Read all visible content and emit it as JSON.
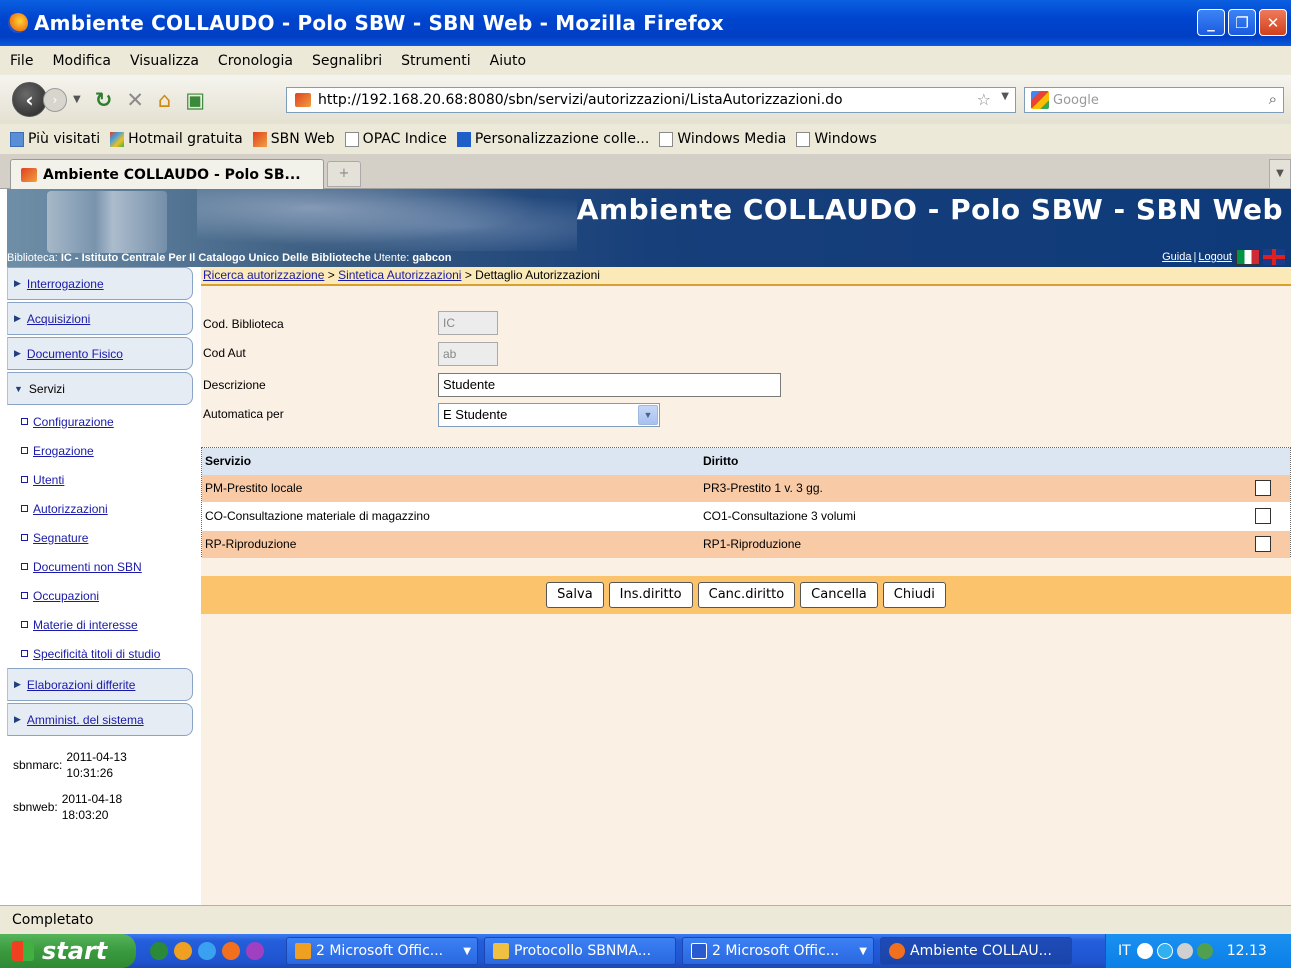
{
  "window": {
    "title": "Ambiente COLLAUDO - Polo SBW - SBN Web - Mozilla Firefox",
    "minimize": "_",
    "maximize": "❐",
    "close": "✕"
  },
  "menu": [
    "File",
    "Modifica",
    "Visualizza",
    "Cronologia",
    "Segnalibri",
    "Strumenti",
    "Aiuto"
  ],
  "navbar": {
    "url": "http://192.168.20.68:8080/sbn/servizi/autorizzazioni/ListaAutorizzazioni.do",
    "search_placeholder": "Google"
  },
  "bookmarks": [
    "Più visitati",
    "Hotmail gratuita",
    "SBN Web",
    "OPAC Indice",
    "Personalizzazione colle...",
    "Windows Media",
    "Windows"
  ],
  "tab": {
    "label": "Ambiente COLLAUDO - Polo SB...",
    "newtab": "+"
  },
  "banner": {
    "title": "Ambiente COLLAUDO - Polo SBW - SBN Web",
    "biblioteca_label": "Biblioteca:",
    "biblioteca_value": "IC - Istituto Centrale Per Il Catalogo Unico Delle Biblioteche",
    "utente_label": "Utente:",
    "utente_value": "gabcon",
    "guida": "Guida",
    "separator": "|",
    "logout": "Logout"
  },
  "breadcrumb": {
    "item1": "Ricerca autorizzazione",
    "sep": " > ",
    "item2": "Sintetica Autorizzazioni",
    "item3": "Dettaglio Autorizzazioni"
  },
  "sidebar": {
    "sections_top": [
      "Interrogazione",
      "Acquisizioni",
      "Documento Fisico"
    ],
    "open_section": "Servizi",
    "subitems": [
      "Configurazione",
      "Erogazione",
      "Utenti",
      "Autorizzazioni",
      "Segnature",
      "Documenti non SBN",
      "Occupazioni",
      "Materie di interesse",
      "Specificità titoli di studio"
    ],
    "sections_bottom": [
      "Elaborazioni differite",
      "Amminist. del sistema"
    ]
  },
  "dates": [
    {
      "label": "sbnmarc:",
      "date": "2011-04-13",
      "time": "10:31:26"
    },
    {
      "label": "sbnweb:",
      "date": "2011-04-18",
      "time": "18:03:20"
    }
  ],
  "form": {
    "cod_biblioteca_label": "Cod. Biblioteca",
    "cod_biblioteca_value": "IC",
    "cod_aut_label": "Cod Aut",
    "cod_aut_value": "ab",
    "descrizione_label": "Descrizione",
    "descrizione_value": "Studente",
    "automatica_label": "Automatica per",
    "automatica_value": "E Studente"
  },
  "table": {
    "headers": [
      "Servizio",
      "Diritto"
    ],
    "rows": [
      {
        "servizio": "PM-Prestito locale",
        "diritto": "PR3-Prestito 1 v. 3 gg."
      },
      {
        "servizio": "CO-Consultazione materiale di magazzino",
        "diritto": "CO1-Consultazione 3 volumi"
      },
      {
        "servizio": "RP-Riproduzione",
        "diritto": "RP1-Riproduzione"
      }
    ]
  },
  "buttons": {
    "salva": "Salva",
    "ins_diritto": "Ins.diritto",
    "canc_diritto": "Canc.diritto",
    "cancella": "Cancella",
    "chiudi": "Chiudi"
  },
  "statusbar": "Completato",
  "taskbar": {
    "start": "start",
    "tasks": [
      "2 Microsoft Offic...",
      "Protocollo SBNMA...",
      "2 Microsoft Offic...",
      "Ambiente COLLAU..."
    ],
    "lang": "IT",
    "clock": "12.13"
  },
  "colors": {
    "titlebar": "#0045cf",
    "banner": "#0e3a7a",
    "content_bg": "#fbf0e4",
    "row_highlight": "#f8caa6",
    "button_bar": "#fbc46c",
    "link": "#1a1aa8"
  }
}
